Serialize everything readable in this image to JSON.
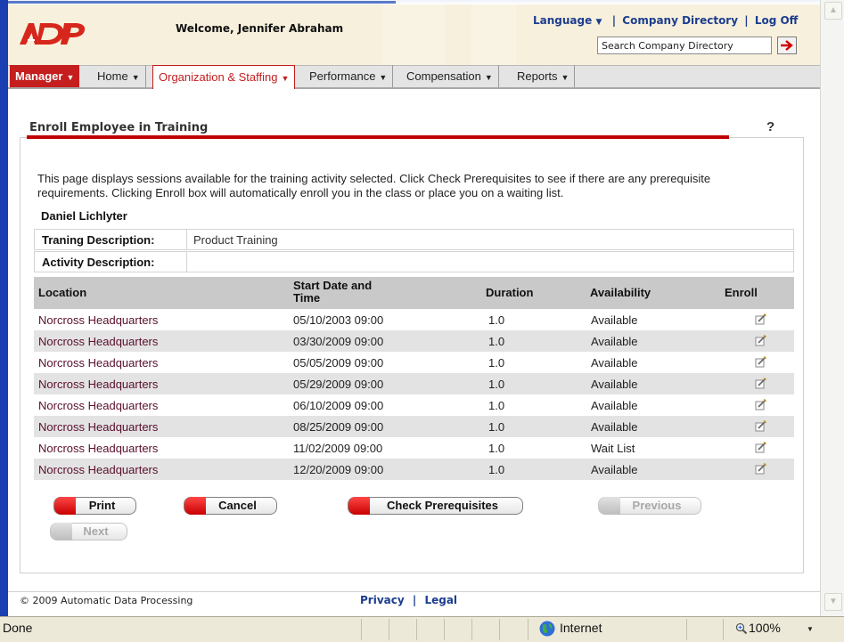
{
  "header": {
    "welcome": "Welcome, Jennifer Abraham",
    "language_label": "Language",
    "company_directory_label": "Company Directory",
    "logout_label": "Log Off",
    "search_value": "Search Company Directory"
  },
  "nav": {
    "items": [
      {
        "label": "Manager"
      },
      {
        "label": "Home"
      },
      {
        "label": "Organization & Staffing"
      },
      {
        "label": "Performance"
      },
      {
        "label": "Compensation"
      },
      {
        "label": "Reports"
      }
    ]
  },
  "page": {
    "title": "Enroll Employee in Training",
    "help": "?",
    "description": "This page displays sessions available for the training activity selected. Click Check Prerequisites to see if there are any prerequisite requirements. Clicking Enroll box will automatically enroll you in the class or place you on a waiting list.",
    "employee_name": "Daniel Lichlyter"
  },
  "info": {
    "training_label": "Traning Description:",
    "training_value": "Product Training",
    "activity_label": "Activity Description:",
    "activity_value": ""
  },
  "table": {
    "headers": [
      "Location",
      "Start Date and Time",
      "Duration",
      "Availability",
      "Enroll"
    ],
    "rows": [
      [
        "Norcross Headquarters",
        "05/10/2003 09:00",
        "1.0",
        "Available"
      ],
      [
        "Norcross Headquarters",
        "03/30/2009 09:00",
        "1.0",
        "Available"
      ],
      [
        "Norcross Headquarters",
        "05/05/2009 09:00",
        "1.0",
        "Available"
      ],
      [
        "Norcross Headquarters",
        "05/29/2009 09:00",
        "1.0",
        "Available"
      ],
      [
        "Norcross Headquarters",
        "06/10/2009 09:00",
        "1.0",
        "Available"
      ],
      [
        "Norcross Headquarters",
        "08/25/2009 09:00",
        "1.0",
        "Available"
      ],
      [
        "Norcross Headquarters",
        "11/02/2009 09:00",
        "1.0",
        "Wait List"
      ],
      [
        "Norcross Headquarters",
        "12/20/2009 09:00",
        "1.0",
        "Available"
      ]
    ]
  },
  "buttons": {
    "print": "Print",
    "cancel": "Cancel",
    "check_prereq": "Check Prerequisites",
    "previous": "Previous",
    "next": "Next"
  },
  "footer": {
    "copyright": "© 2009 Automatic Data Processing",
    "privacy": "Privacy",
    "legal": "Legal"
  },
  "statusbar": {
    "status": "Done",
    "zone": "Internet",
    "zoom": "100%"
  },
  "colors": {
    "brand_red": "#c00000",
    "link_blue": "#1c3d8f",
    "location_text": "#5a0f2e"
  }
}
